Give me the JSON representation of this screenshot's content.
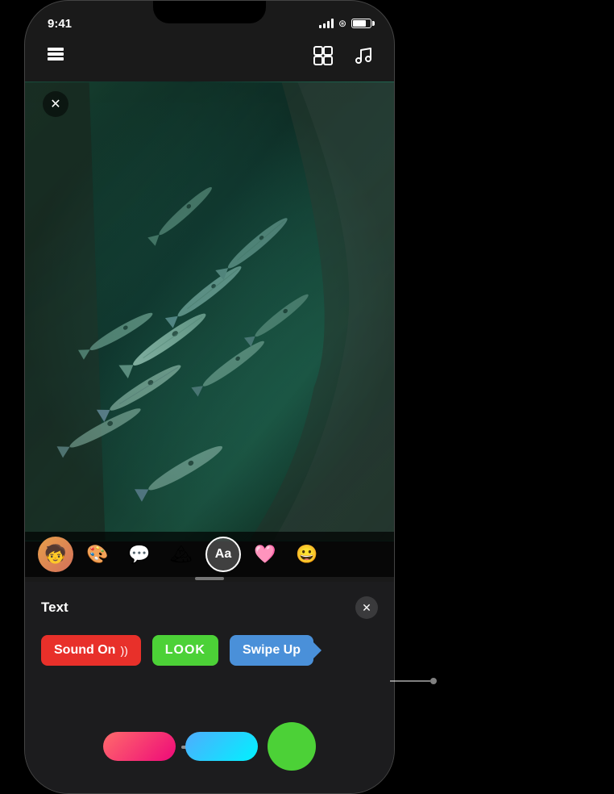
{
  "phone": {
    "time": "9:41",
    "battery_level": "75%"
  },
  "toolbar": {
    "stacks_icon": "⊞",
    "music_icon": "♪",
    "close_icon": "✕"
  },
  "panel": {
    "title": "Text",
    "close_label": "✕"
  },
  "stickers": [
    {
      "id": "sound-on",
      "label": "Sound On",
      "suffix": "))",
      "bg_color": "#e8302a",
      "text_color": "#ffffff"
    },
    {
      "id": "look",
      "label": "LOOK",
      "bg_color": "#4cd137",
      "text_color": "#ffffff"
    },
    {
      "id": "swipe-up",
      "label": "Swipe Up",
      "bg_color": "#4a90d9",
      "text_color": "#ffffff"
    }
  ],
  "icons": {
    "avatar": "🧒",
    "colors": "🎨",
    "message": "💬",
    "shapes": "🏔",
    "text": "Aa",
    "sticker": "🩷",
    "emoji": "😀"
  }
}
